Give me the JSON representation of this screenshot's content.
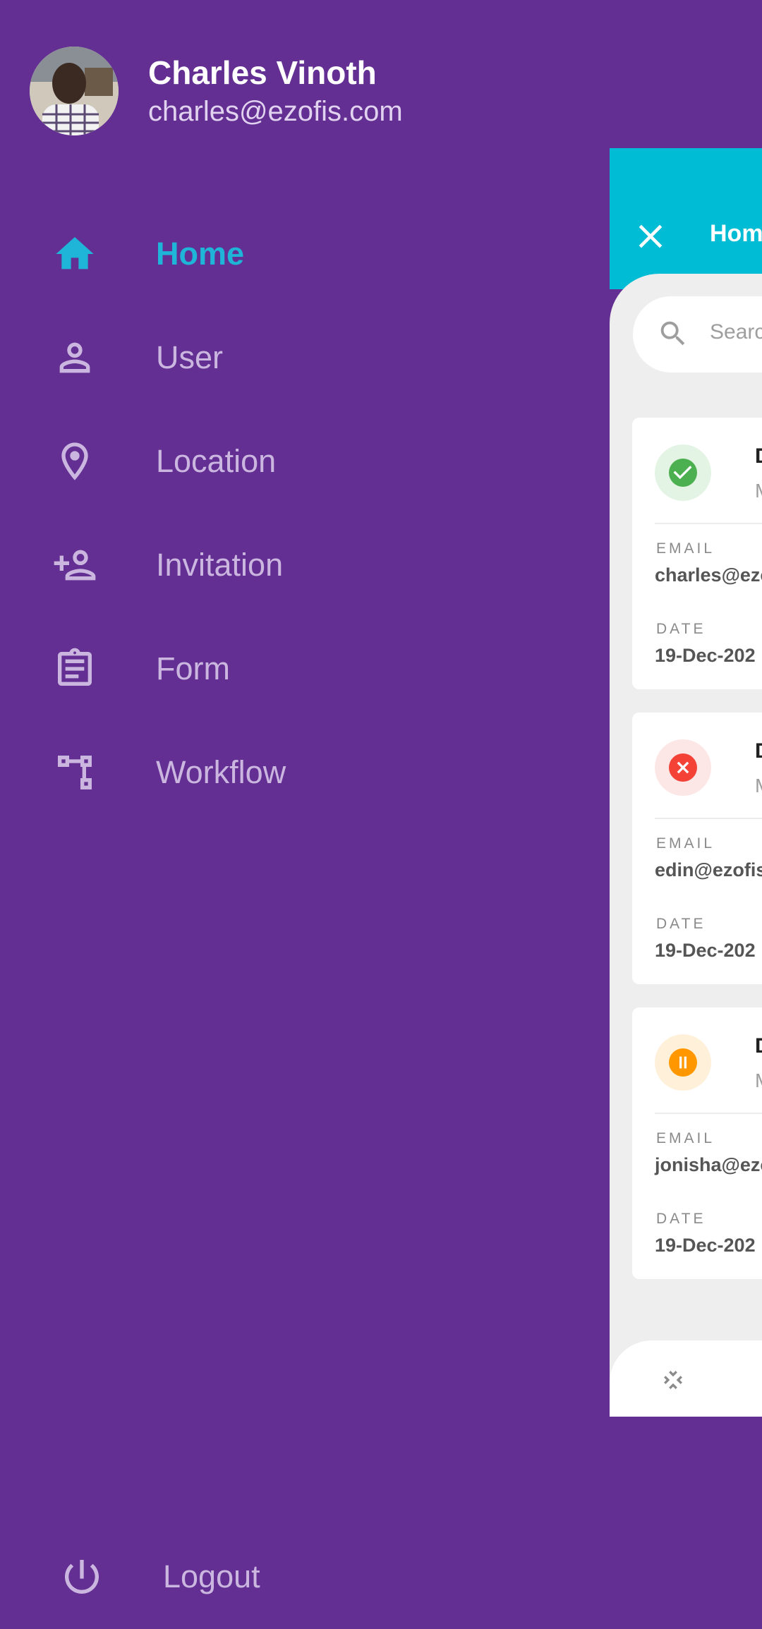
{
  "profile": {
    "name": "Charles Vinoth",
    "email": "charles@ezofis.com"
  },
  "menu": {
    "items": [
      {
        "label": "Home",
        "icon": "home-icon",
        "active": true
      },
      {
        "label": "User",
        "icon": "person-icon",
        "active": false
      },
      {
        "label": "Location",
        "icon": "location-pin-icon",
        "active": false
      },
      {
        "label": "Invitation",
        "icon": "person-add-icon",
        "active": false
      },
      {
        "label": "Form",
        "icon": "clipboard-icon",
        "active": false
      },
      {
        "label": "Workflow",
        "icon": "workflow-icon",
        "active": false
      }
    ],
    "logout_label": "Logout"
  },
  "panel": {
    "title": "Hom",
    "search_placeholder": "Searc",
    "cards": [
      {
        "status": "approved",
        "status_color": "#4caf50",
        "title": "DE_",
        "subtitle": "Mo",
        "email_label": "EMAIL",
        "email": "charles@ezo",
        "date_label": "DATE",
        "date": "19-Dec-202"
      },
      {
        "status": "rejected",
        "status_color": "#f44336",
        "title": "DE_",
        "subtitle": "Mo",
        "email_label": "EMAIL",
        "email": "edin@ezofis",
        "date_label": "DATE",
        "date": "19-Dec-202"
      },
      {
        "status": "paused",
        "status_color": "#ff9800",
        "title": "DE_",
        "subtitle": "Mo",
        "email_label": "EMAIL",
        "email": "jonisha@ezo",
        "date_label": "DATE",
        "date": "19-Dec-202"
      }
    ]
  },
  "colors": {
    "drawer_bg": "#632f93",
    "accent": "#1fb5d8",
    "header_bg": "#00bcd4"
  }
}
